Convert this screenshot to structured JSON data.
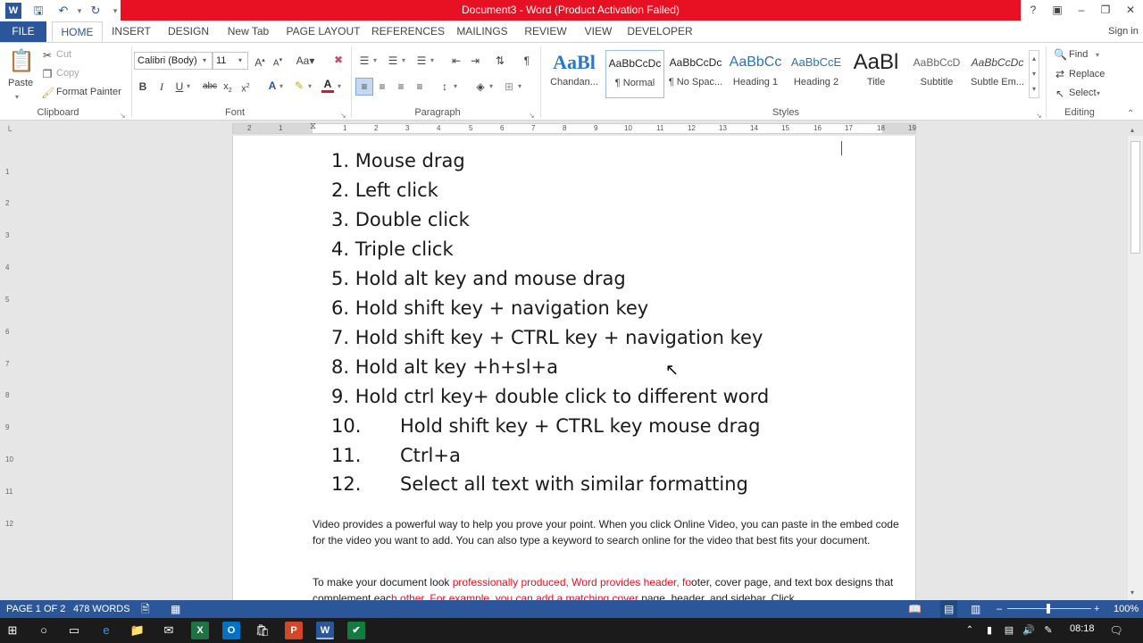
{
  "window": {
    "title": "Document3 - Word (Product Activation Failed)",
    "help": "?",
    "sign_in": "Sign in"
  },
  "qat": [
    "word-logo",
    "save",
    "undo",
    "redo"
  ],
  "tabs": [
    "FILE",
    "HOME",
    "INSERT",
    "DESIGN",
    "New Tab",
    "PAGE LAYOUT",
    "REFERENCES",
    "MAILINGS",
    "REVIEW",
    "VIEW",
    "DEVELOPER"
  ],
  "clipboard": {
    "paste": "Paste",
    "cut": "Cut",
    "copy": "Copy",
    "format_painter": "Format Painter",
    "label": "Clipboard"
  },
  "font": {
    "family": "Calibri (Body)",
    "size": "11",
    "label": "Font"
  },
  "paragraph": {
    "label": "Paragraph"
  },
  "styles": {
    "label": "Styles",
    "items": [
      {
        "preview": "AaBl",
        "name": "Chandan..."
      },
      {
        "preview": "AaBbCcDc",
        "name": "¶ Normal"
      },
      {
        "preview": "AaBbCcDc",
        "name": "¶ No Spac..."
      },
      {
        "preview": "AaBbCc",
        "name": "Heading 1"
      },
      {
        "preview": "AaBbCcE",
        "name": "Heading 2"
      },
      {
        "preview": "AaBl",
        "name": "Title"
      },
      {
        "preview": "AaBbCcD",
        "name": "Subtitle"
      },
      {
        "preview": "AaBbCcDc",
        "name": "Subtle Em..."
      }
    ]
  },
  "editing": {
    "find": "Find",
    "replace": "Replace",
    "select": "Select",
    "label": "Editing"
  },
  "ruler": [
    "2",
    "1",
    "1",
    "2",
    "3",
    "4",
    "5",
    "6",
    "7",
    "8",
    "9",
    "10",
    "11",
    "12",
    "13",
    "14",
    "15",
    "16",
    "17",
    "18",
    "19"
  ],
  "vruler": [
    "1",
    "2",
    "3",
    "4",
    "5",
    "6",
    "7",
    "8",
    "9",
    "10",
    "11",
    "12"
  ],
  "document": {
    "list": [
      {
        "num": "1.",
        "text": "Mouse drag"
      },
      {
        "num": "2.",
        "text": "Left click"
      },
      {
        "num": "3.",
        "text": "Double click"
      },
      {
        "num": "4.",
        "text": "Triple click"
      },
      {
        "num": "5.",
        "text": "Hold alt key and mouse drag"
      },
      {
        "num": "6.",
        "text": "Hold shift key + navigation key"
      },
      {
        "num": "7.",
        "text": "Hold shift key + CTRL key + navigation key"
      },
      {
        "num": "8.",
        "text": "Hold alt key +h+sl+a"
      },
      {
        "num": "9.",
        "text": "Hold ctrl key+ double click to different word"
      },
      {
        "num": "10.",
        "text": "Hold shift key + CTRL key mouse drag"
      },
      {
        "num": "11.",
        "text": "Ctrl+a"
      },
      {
        "num": "12.",
        "text": "Select all text with similar formatting"
      }
    ],
    "para1": "Video provides a powerful way to help you prove your point. When you click Online Video, you can paste in the embed code for the video you want to add. You can also type a keyword to search online for the video that best fits your document.",
    "para2_a": "To make your document look ",
    "para2_b": "professionally produced, Word provides header, fo",
    "para2_c": "oter, cover page, and text box",
    "para2_d": "designs that complement eac",
    "para2_e": "h other. For example, you can add a matching cover",
    "para2_f": " page, header, and sidebar. Click"
  },
  "status": {
    "page": "PAGE 1 OF 2",
    "words": "478 WORDS",
    "zoom": "100%"
  },
  "taskbar": {
    "time": "08:18"
  },
  "colors": {
    "accent": "#2b579a",
    "title_bar": "#e81123",
    "red_text": "#e81123"
  }
}
